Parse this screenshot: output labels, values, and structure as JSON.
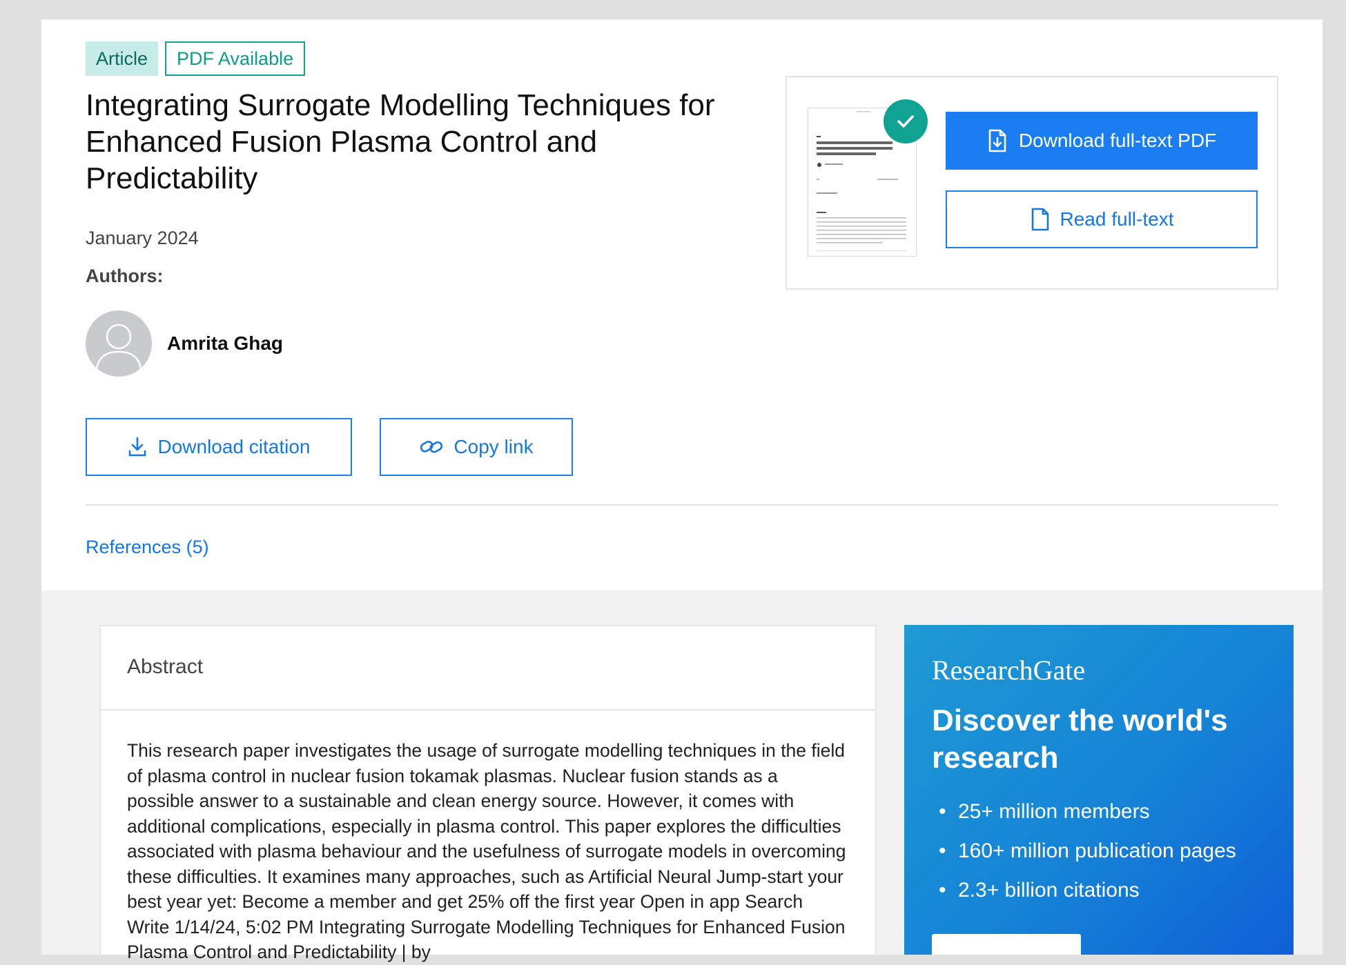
{
  "badges": {
    "article": "Article",
    "pdf": "PDF Available"
  },
  "title": "Integrating Surrogate Modelling Techniques for Enhanced Fusion Plasma Control and Predictability",
  "date": "January 2024",
  "authors_label": "Authors:",
  "author": {
    "name": "Amrita Ghag"
  },
  "actions": {
    "download_citation": "Download citation",
    "copy_link": "Copy link"
  },
  "references": "References (5)",
  "pdf_panel": {
    "download": "Download full-text PDF",
    "read": "Read full-text"
  },
  "abstract": {
    "heading": "Abstract",
    "text": "This research paper investigates the usage of surrogate modelling techniques in the field of plasma control in nuclear fusion tokamak plasmas. Nuclear fusion stands as a possible answer to a sustainable and clean energy source. However, it comes with additional complications, especially in plasma control. This paper explores the difficulties associated with plasma behaviour and the usefulness of surrogate models in overcoming these difficulties. It examines many approaches, such as Artificial Neural Jump-start your best year yet: Become a member and get 25% off the first year Open in app Search Write 1/14/24, 5:02 PM Integrating Surrogate Modelling Techniques for Enhanced Fusion Plasma Control and Predictability | by"
  },
  "promo": {
    "logo": "ResearchGate",
    "heading": "Discover the world's research",
    "items": [
      "25+ million members",
      "160+ million publication pages",
      "2.3+ billion citations"
    ]
  },
  "colors": {
    "accent": "#1a7ef2",
    "teal": "#10a393",
    "badge_bg": "#c7ebe6"
  }
}
